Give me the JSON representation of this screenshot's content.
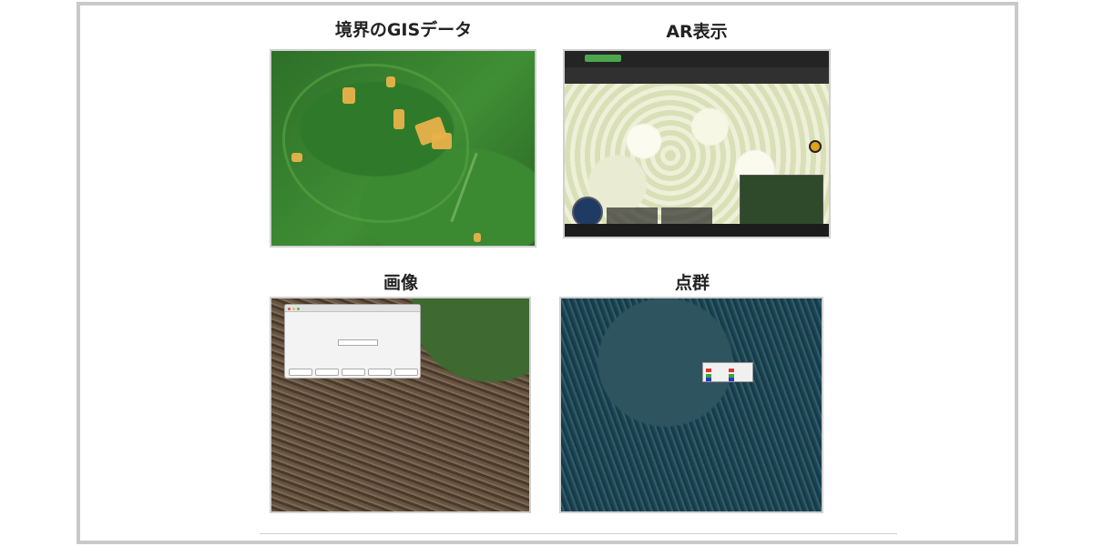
{
  "headings": {
    "gis": "境界のGISデータ",
    "ar": "AR表示",
    "image": "画像",
    "point_cloud": "点群"
  },
  "colors": {
    "frame_border": "#c9c9c9",
    "heading_text": "#222222",
    "gis_boundary": "#e8b24a"
  }
}
